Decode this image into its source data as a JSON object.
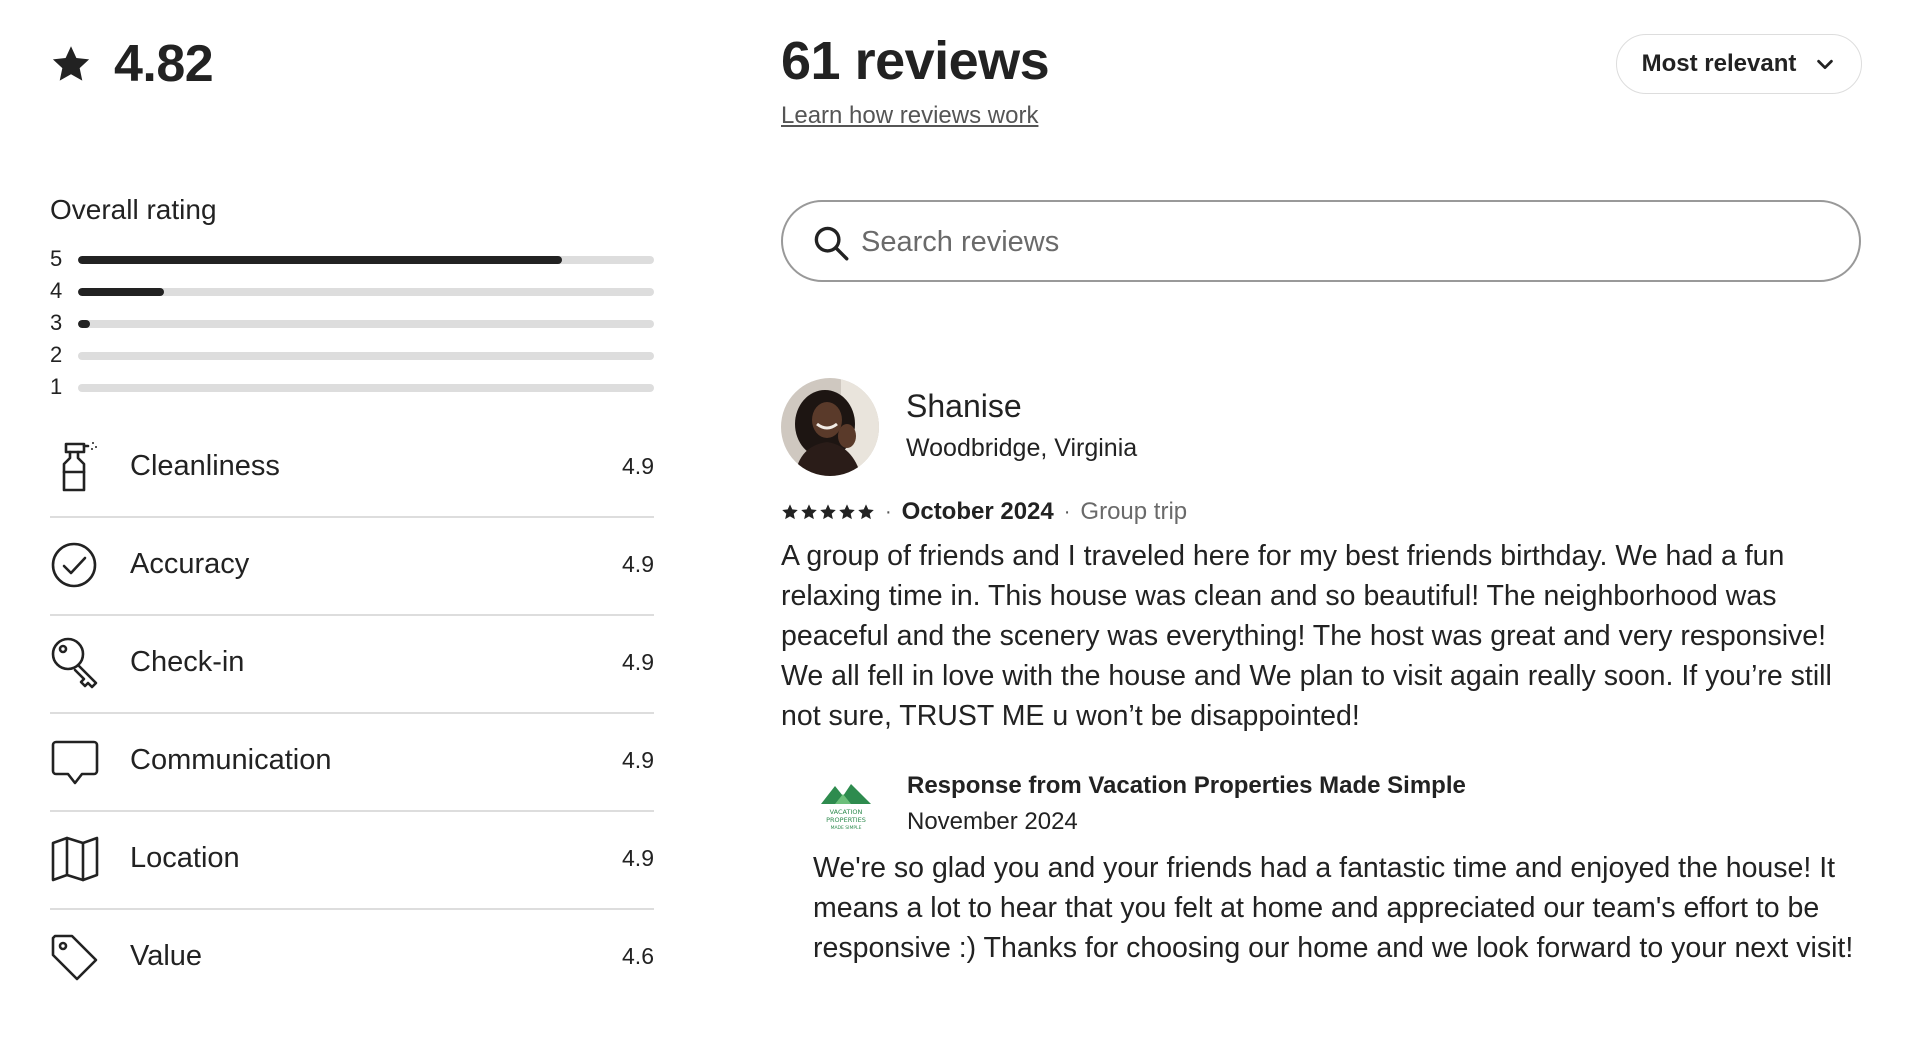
{
  "summary": {
    "average_rating": "4.82",
    "review_count_label": "61 reviews",
    "learn_link": "Learn how reviews work"
  },
  "sort": {
    "selected": "Most relevant"
  },
  "search": {
    "placeholder": "Search reviews",
    "value": ""
  },
  "overall": {
    "title": "Overall rating",
    "bars": [
      {
        "label": "5",
        "fraction": 0.84
      },
      {
        "label": "4",
        "fraction": 0.15
      },
      {
        "label": "3",
        "fraction": 0.02
      },
      {
        "label": "2",
        "fraction": 0.0
      },
      {
        "label": "1",
        "fraction": 0.0
      }
    ]
  },
  "categories": [
    {
      "name": "Cleanliness",
      "value": "4.9",
      "icon": "spray-bottle-icon"
    },
    {
      "name": "Accuracy",
      "value": "4.9",
      "icon": "check-circle-icon"
    },
    {
      "name": "Check-in",
      "value": "4.9",
      "icon": "key-icon"
    },
    {
      "name": "Communication",
      "value": "4.9",
      "icon": "chat-bubble-icon"
    },
    {
      "name": "Location",
      "value": "4.9",
      "icon": "map-icon"
    },
    {
      "name": "Value",
      "value": "4.6",
      "icon": "tag-icon"
    }
  ],
  "review": {
    "name": "Shanise",
    "location": "Woodbridge, Virginia",
    "stars": 5,
    "date": "October 2024",
    "trip_type": "Group trip",
    "separator": "·",
    "text": "A group of friends and I traveled here for my best friends birthday. We had a fun relaxing time in. This house was clean and so beautiful! The neighborhood was peaceful and the scenery was everything! The host was great and very responsive! We all fell in love with the house and We plan to visit again really soon. If you’re still not sure, TRUST ME u won’t be disappointed!",
    "response": {
      "title": "Response from Vacation Properties Made Simple",
      "date": "November 2024",
      "text": "We're so glad you and your friends had a fantastic time and enjoyed the house! It means a lot to hear that you felt at home and appreciated our team's effort to be responsive :) Thanks for choosing our home and we look forward to your next visit!",
      "logo_text": "VACATION PROPERTIES MADE SIMPLE"
    }
  },
  "colors": {
    "text": "#222222",
    "muted": "#6a6a6a",
    "bar_track": "#dddddd",
    "divider": "#dddddd",
    "logo_green": "#2e8b4e",
    "logo_green_light": "#6cbf7a"
  }
}
